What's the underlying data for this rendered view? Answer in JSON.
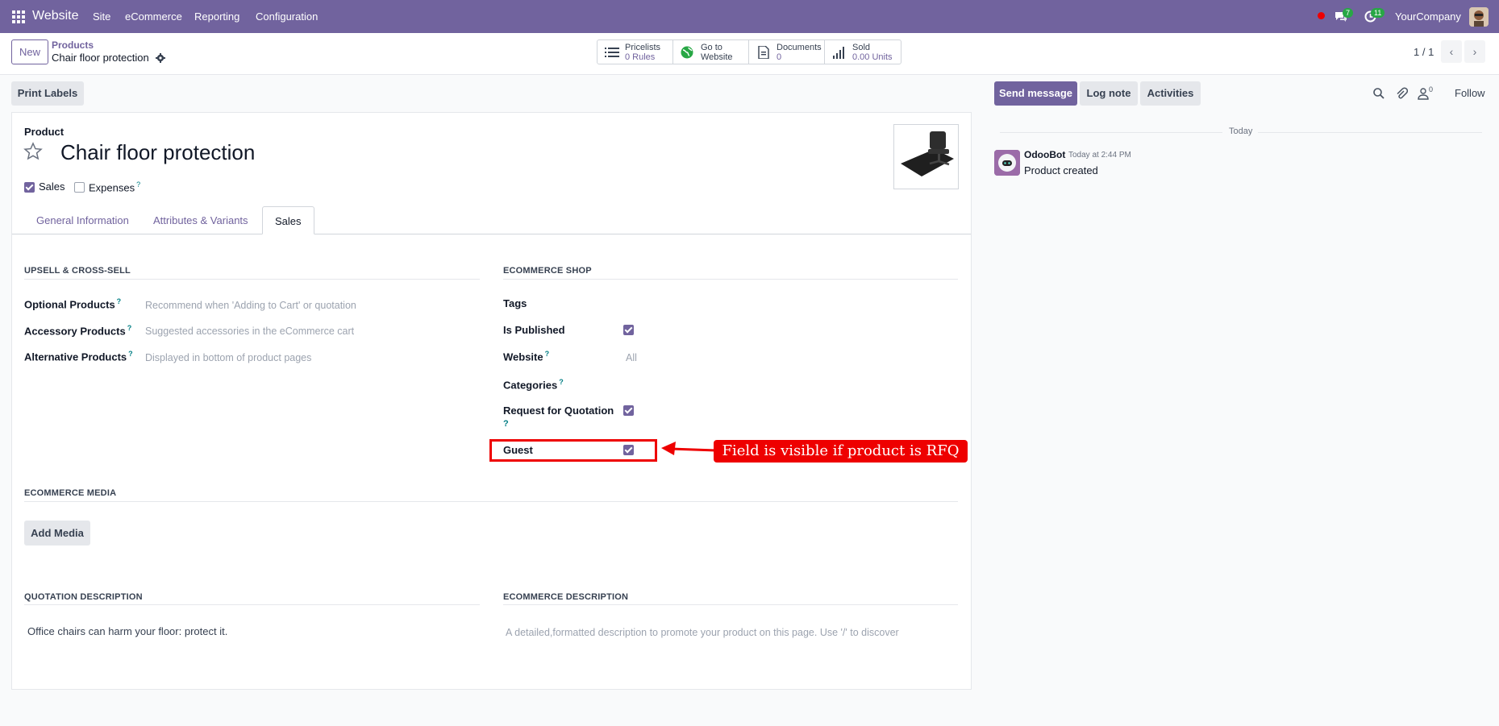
{
  "navbar": {
    "app_name": "Website",
    "menus": [
      "Site",
      "eCommerce",
      "Reporting",
      "Configuration"
    ],
    "messages_badge": "7",
    "activities_badge": "11",
    "company": "YourCompany",
    "color": "#71639e"
  },
  "control_panel": {
    "new_label": "New",
    "breadcrumb_parent": "Products",
    "breadcrumb_current": "Chair floor protection",
    "smart_buttons": [
      {
        "icon": "list-icon",
        "line1": "Pricelists",
        "line2": "0  Rules"
      },
      {
        "icon": "globe-icon",
        "line1": "Go to",
        "line2": "Website"
      },
      {
        "icon": "document-icon",
        "line1": "Documents",
        "line2": "0"
      },
      {
        "icon": "bar-chart-icon",
        "line1": "Sold",
        "line2": "0.00 Units"
      }
    ],
    "pager": "1 / 1"
  },
  "form": {
    "print_labels": "Print Labels",
    "product_label": "Product",
    "product_name": "Chair floor protection",
    "sales_label": "Sales",
    "sales_checked": true,
    "expenses_label": "Expenses",
    "expenses_checked": false,
    "tabs": [
      "General Information",
      "Attributes & Variants",
      "Sales"
    ],
    "active_tab": "Sales",
    "upsell": {
      "header": "UPSELL & CROSS-SELL",
      "fields": [
        {
          "label": "Optional Products",
          "placeholder": "Recommend when 'Adding to Cart' or quotation"
        },
        {
          "label": "Accessory Products",
          "placeholder": "Suggested accessories in the eCommerce cart"
        },
        {
          "label": "Alternative Products",
          "placeholder": "Displayed in bottom of product pages"
        }
      ]
    },
    "shop": {
      "header": "ECOMMERCE SHOP",
      "tags_label": "Tags",
      "is_published_label": "Is Published",
      "is_published": true,
      "website_label": "Website",
      "website_placeholder": "All",
      "categories_label": "Categories",
      "rfq_label": "Request for Quotation",
      "rfq_q": "?",
      "rfq": true,
      "guest_label": "Guest",
      "guest": true
    },
    "media": {
      "header": "ECOMMERCE MEDIA",
      "add_media": "Add Media"
    },
    "quotation": {
      "header": "QUOTATION DESCRIPTION",
      "text": "Office chairs can harm your floor: protect it."
    },
    "ecommerce_desc": {
      "header": "ECOMMERCE DESCRIPTION",
      "placeholder": "A detailed,formatted description to promote your product on this page. Use '/' to discover"
    }
  },
  "annotation": {
    "text": "Field is visible if product is RFQ",
    "color": "#ee0000"
  },
  "chatter": {
    "send_message": "Send message",
    "log_note": "Log note",
    "activities": "Activities",
    "followers_count": "0",
    "follow": "Follow",
    "date_separator": "Today",
    "author": "OdooBot",
    "time": "Today at 2:44 PM",
    "message": "Product created"
  }
}
